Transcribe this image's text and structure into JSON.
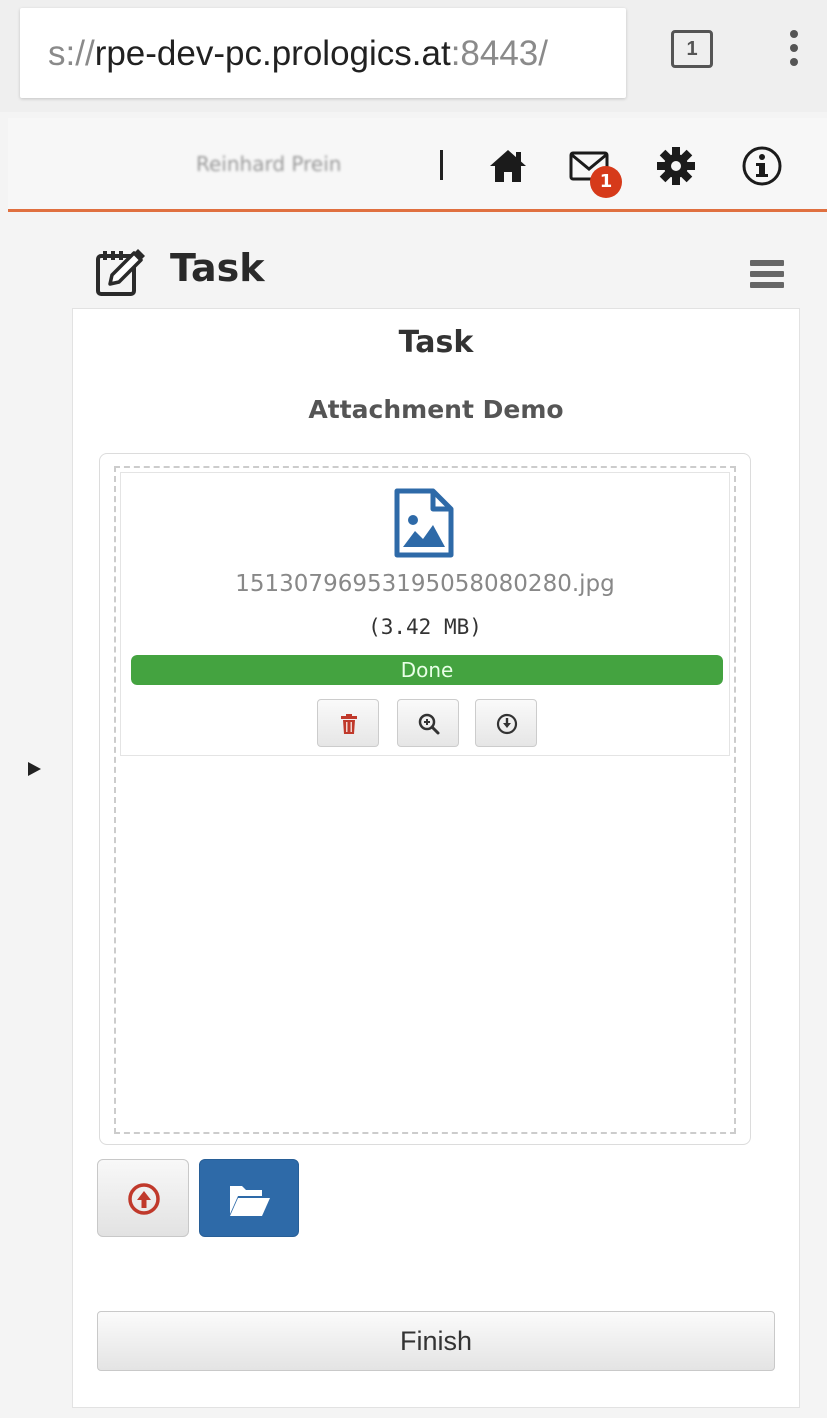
{
  "browser": {
    "url_prefix": "s://",
    "url_host": "rpe-dev-pc.prologics.at",
    "url_rest": ":8443/",
    "tab_count": "1"
  },
  "header": {
    "user_name": "Reinhard Prein",
    "separator": "|",
    "mail_badge": "1",
    "accent_color": "#e07040"
  },
  "page": {
    "title": "Task"
  },
  "card": {
    "title": "Task",
    "subtitle": "Attachment Demo"
  },
  "attachment": {
    "file_name": "15130796953195058080280.jpg",
    "file_size": "(3.42 MB)",
    "progress_label": "Done",
    "progress_percent": 100,
    "progress_color": "#44a340"
  },
  "actions": {
    "finish_label": "Finish"
  },
  "icons": {
    "home": "home-icon",
    "mail": "mail-icon",
    "settings": "gear-icon",
    "info": "info-icon",
    "task": "task-edit-icon",
    "menu": "hamburger-icon",
    "file": "image-file-icon",
    "delete": "trash-icon",
    "zoom": "zoom-in-icon",
    "download": "download-icon",
    "upload": "upload-icon",
    "browse": "folder-open-icon"
  }
}
